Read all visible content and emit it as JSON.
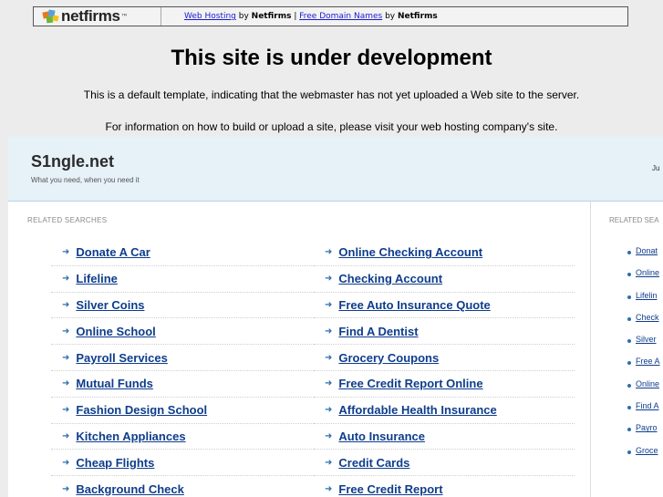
{
  "topbar": {
    "logo_text": "netfirms",
    "logo_tm": "™",
    "link1": "Web Hosting",
    "by1": " by ",
    "brand1": "Netfirms",
    "sep": " | ",
    "link2": "Free Domain Names",
    "by2": " by ",
    "brand2": "Netfirms"
  },
  "heading": "This site is under development",
  "line1": "This is a default template, indicating that the webmaster has not yet uploaded a Web site to the server.",
  "line2": "For information on how to build or upload a site, please visit your web hosting company's site.",
  "frame": {
    "site_name": "S1ngle.net",
    "tagline": "What you need, when you need it",
    "header_right": "Ju",
    "related_label": "RELATED SEARCHES",
    "right_label": "RELATED SEA",
    "links": [
      "Donate A Car",
      "Online Checking Account",
      "Lifeline",
      "Checking Account",
      "Silver Coins",
      "Free Auto Insurance Quote",
      "Online School",
      "Find A Dentist",
      "Payroll Services",
      "Grocery Coupons",
      "Mutual Funds",
      "Free Credit Report Online",
      "Fashion Design School",
      "Affordable Health Insurance",
      "Kitchen Appliances",
      "Auto Insurance",
      "Cheap Flights",
      "Credit Cards",
      "Background Check",
      "Free Credit Report"
    ],
    "right_links": [
      "Donat",
      "Online",
      "Lifelin",
      "Check",
      "Silver",
      "Free A",
      "Online",
      "Find A",
      "Payro",
      "Groce"
    ]
  }
}
